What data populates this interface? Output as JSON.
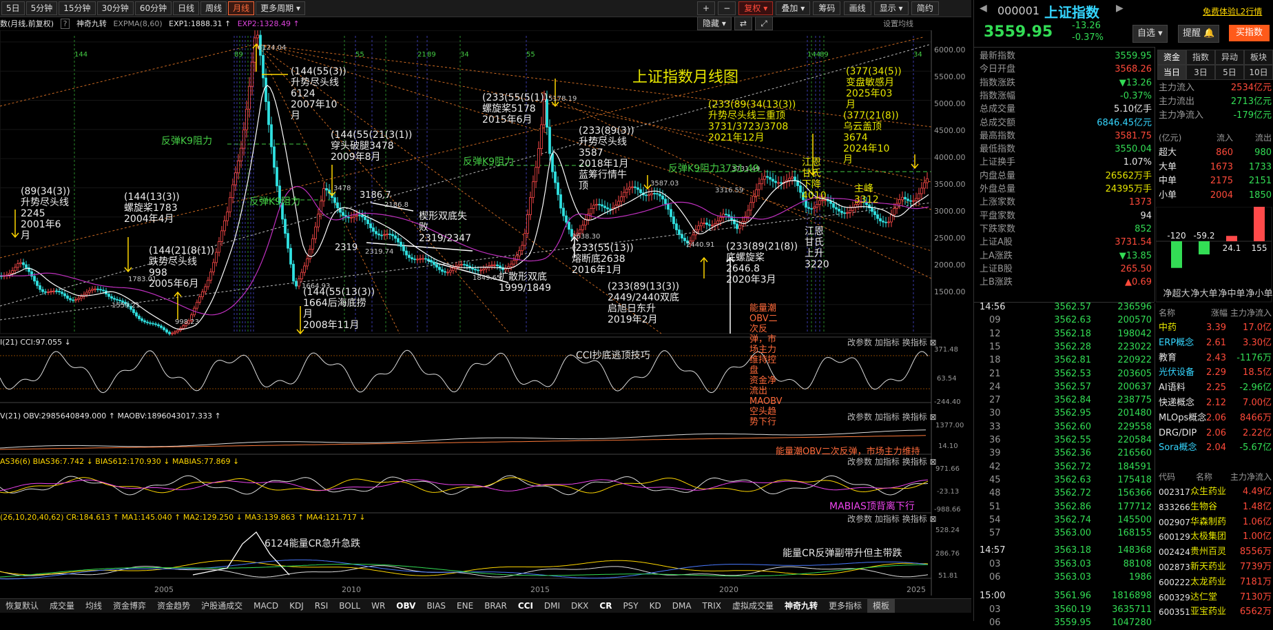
{
  "toolbar": {
    "periods": [
      "5日",
      "5分钟",
      "15分钟",
      "30分钟",
      "60分钟",
      "日线",
      "周线",
      "月线",
      "更多周期"
    ],
    "active_period": "月线",
    "controls": [
      "+",
      "−",
      "复权",
      "叠加",
      "筹码",
      "画线",
      "显示",
      "简约",
      "隐藏"
    ],
    "window_icons": [
      "⇄",
      "⤢"
    ]
  },
  "infoline": {
    "prefix": "数(月线,前复权)",
    "help": "?",
    "indicator": "神奇九转",
    "expma": "EXPMA(8,60)",
    "exp1": "EXP1:1888.31 ↑",
    "exp2": "EXP2:1328.49 ↑",
    "settings": "设置均线"
  },
  "chart": {
    "title": "上证指数月线图",
    "y_ticks": [
      "6000.00",
      "5500.00",
      "5000.00",
      "4500.00",
      "4000.00",
      "3500.00",
      "3000.00",
      "2500.00",
      "2000.00",
      "1500.00"
    ],
    "x_ticks": [
      "2005",
      "2010",
      "2015",
      "2020",
      "2025"
    ],
    "top_numbers": [
      "144",
      "89",
      "55",
      "89",
      "144",
      "89",
      "21",
      "34",
      "55",
      "34"
    ],
    "price_labels": [
      "6124.04",
      "5178.19",
      "3731.49",
      "3587.03",
      "3316.59",
      "3186.7",
      "3478",
      "2319",
      "2319.74",
      "1849.65",
      "1664.93",
      "1783.01",
      "998.23",
      "1559.21",
      "2638.30",
      "2440.91",
      "2186.8"
    ],
    "annotations": [
      {
        "lines": [
          "(144(55(3))",
          "升势尽头线6124",
          "2007年10月"
        ]
      },
      {
        "lines": [
          "(233(55(5(1))",
          "螺旋桨5178",
          "2015年6月"
        ]
      },
      {
        "lines": [
          "(377(34(5))",
          "变盘敏感月",
          "2025年03月"
        ]
      },
      {
        "lines": [
          "(233(89(34(13(3))",
          "升势尽头线三重顶",
          "3731/3723/3708",
          "2021年12月"
        ]
      },
      {
        "lines": [
          "(377(21(8))",
          "乌云盖顶3674",
          "2024年10月"
        ]
      },
      {
        "lines": [
          "(144(55(21(3(1))",
          "穿头破腿3478",
          "2009年8月"
        ]
      },
      {
        "lines": [
          "(233(89(3))",
          "升势尽头线3587",
          "2018年1月蓝筹行情牛顶"
        ]
      },
      {
        "lines": [
          "(89(34(3))",
          "升势尽头线2245",
          "2001年6月"
        ]
      },
      {
        "lines": [
          "(144(13(3))",
          "螺旋桨1783",
          "2004年4月"
        ]
      },
      {
        "lines": [
          "(144(21(8(1))",
          "跌势尽头线998",
          "2005年6月"
        ]
      },
      {
        "lines": [
          "(144(55(13(3))",
          "1664后海底捞月",
          "2008年11月"
        ]
      },
      {
        "lines": [
          "楔形双底失败",
          "2319/2347"
        ]
      },
      {
        "lines": [
          "扩散形双底",
          "1999/1849"
        ]
      },
      {
        "lines": [
          "(233(55(13))",
          "熔断底2638",
          "2016年1月"
        ]
      },
      {
        "lines": [
          "(233(89(13(3))",
          "2449/2440双底",
          "启旭日东升",
          "2019年2月"
        ]
      },
      {
        "lines": [
          "(233(89(21(8))",
          "底螺旋桨2646.8",
          "2020年3月"
        ]
      },
      {
        "lines": [
          "主峰3312"
        ]
      },
      {
        "lines": [
          "江恩甘氏下降4010"
        ]
      },
      {
        "lines": [
          "江恩甘氏上升3220"
        ]
      },
      {
        "lines": [
          "能量潮OBV二次反弹，市场主力维持控盘",
          "资金净流出MAOBV空头趋势下行"
        ]
      }
    ],
    "resist_labels": [
      "反弹K9阻力",
      "反弹K9阻力",
      "反弹K9阻力",
      "反弹K9阻力3731.49"
    ],
    "sub_options": [
      "改参数",
      "加指标",
      "换指标",
      "⊠"
    ],
    "panels": [
      {
        "header": "I(21) CCI:97.055 ↓",
        "note": "CCI抄底逃顶技巧",
        "ticks": [
          "371.48",
          "63.54",
          "-244.40"
        ]
      },
      {
        "header": "V(21) OBV:2985640849.000 ↑ MAOBV:1896043017.333 ↑",
        "note": "能量潮OBV二次反弹，市场主力维持",
        "ticks": [
          "1377.00",
          "14.10"
        ]
      },
      {
        "header": "AS36(6) BIAS36:7.742 ↓ BIAS612:170.930 ↓ MABIAS:77.869 ↓",
        "note": "MABIAS顶背离下行",
        "ticks": [
          "971.66",
          "-23.13",
          "-988.66"
        ]
      },
      {
        "header": "(26,10,20,40,62) CR:184.613 ↑ MA1:145.040 ↑ MA2:129.250 ↓ MA3:139.863 ↑ MA4:121.717 ↓",
        "note1": "6124能量CR急升急跌",
        "note2": "能量CR反弹副带升但主带跌",
        "ticks": [
          "528.24",
          "286.76",
          "51.81"
        ]
      }
    ]
  },
  "bottom_tabs": [
    "恢复默认",
    "成交量",
    "均线",
    "资金博弈",
    "资金趋势",
    "沪股通成交",
    "MACD",
    "KDJ",
    "RSI",
    "BOLL",
    "WR",
    "OBV",
    "BIAS",
    "ENE",
    "BRAR",
    "CCI",
    "DMI",
    "DKX",
    "CR",
    "PSY",
    "KD",
    "DMA",
    "TRIX",
    "虚拟成交量",
    "神奇九转",
    "更多指标",
    "模板"
  ],
  "quote": {
    "code": "000001",
    "name": "上证指数",
    "promo": "免费体验L2行情",
    "price": "3559.95",
    "change": "-13.26",
    "change_pct": "-0.37%",
    "btn_watch": "自选",
    "btn_alert": "提醒",
    "btn_buy": "买指数",
    "stats": [
      {
        "label": "最新指数",
        "value": "3559.95",
        "cls": "dn"
      },
      {
        "label": "今日开盘",
        "value": "3568.26",
        "cls": "up"
      },
      {
        "label": "指数涨跌",
        "value": "▼13.26",
        "cls": "dn"
      },
      {
        "label": "指数涨幅",
        "value": "-0.37%",
        "cls": "dn"
      },
      {
        "label": "总成交量",
        "value": "5.10亿手",
        "cls": "wht"
      },
      {
        "label": "总成交额",
        "value": "6846.45亿元",
        "cls": "cyan"
      },
      {
        "label": "最高指数",
        "value": "3581.75",
        "cls": "up"
      },
      {
        "label": "最低指数",
        "value": "3550.04",
        "cls": "dn"
      },
      {
        "label": "上证换手",
        "value": "1.07%",
        "cls": "wht"
      },
      {
        "label": "内盘总量",
        "value": "26562万手",
        "cls": "yel"
      },
      {
        "label": "外盘总量",
        "value": "24395万手",
        "cls": "yel"
      },
      {
        "label": "上涨家数",
        "value": "1373",
        "cls": "up"
      },
      {
        "label": "平盘家数",
        "value": "94",
        "cls": "wht"
      },
      {
        "label": "下跌家数",
        "value": "852",
        "cls": "dn"
      },
      {
        "label": "上证A股",
        "value": "3731.54",
        "cls": "up"
      },
      {
        "label": "上A涨跌",
        "value": "▼13.85",
        "cls": "dn"
      },
      {
        "label": "上证B股",
        "value": "265.50",
        "cls": "up"
      },
      {
        "label": "上B涨跌",
        "value": "▲0.69",
        "cls": "up"
      }
    ],
    "flow_tabs_1": [
      "资金",
      "指数",
      "异动",
      "板块"
    ],
    "flow_tabs_2": [
      "当日",
      "3日",
      "5日",
      "10日"
    ],
    "main_flow": [
      {
        "label": "主力流入",
        "value": "2534亿元",
        "cls": "up"
      },
      {
        "label": "主力流出",
        "value": "2713亿元",
        "cls": "dn"
      },
      {
        "label": "主力净流入",
        "value": "-179亿元",
        "cls": "dn"
      }
    ],
    "flow_head": [
      "(亿元)",
      "流入",
      "流出"
    ],
    "flow_rows": [
      {
        "label": "超大",
        "in": "860",
        "out": "980"
      },
      {
        "label": "大单",
        "in": "1673",
        "out": "1733"
      },
      {
        "label": "中单",
        "in": "2175",
        "out": "2151"
      },
      {
        "label": "小单",
        "in": "2004",
        "out": "1850"
      }
    ],
    "net_bars": [
      {
        "label": "净超大",
        "value": -120,
        "text": "-120"
      },
      {
        "label": "净大单",
        "value": -59.2,
        "text": "-59.2"
      },
      {
        "label": "净中单",
        "value": 24.1,
        "text": "24.1"
      },
      {
        "label": "净小单",
        "value": 155,
        "text": "155"
      }
    ],
    "ticks": [
      {
        "time": "14:56",
        "price": "3562.57",
        "vol": "236596"
      },
      {
        "time": "09",
        "price": "3562.63",
        "vol": "200570"
      },
      {
        "time": "12",
        "price": "3562.18",
        "vol": "198042"
      },
      {
        "time": "15",
        "price": "3562.28",
        "vol": "223022"
      },
      {
        "time": "18",
        "price": "3562.81",
        "vol": "220922"
      },
      {
        "time": "21",
        "price": "3562.53",
        "vol": "203605"
      },
      {
        "time": "24",
        "price": "3562.57",
        "vol": "200637"
      },
      {
        "time": "27",
        "price": "3562.84",
        "vol": "238775"
      },
      {
        "time": "30",
        "price": "3562.95",
        "vol": "201480"
      },
      {
        "time": "33",
        "price": "3562.60",
        "vol": "229558"
      },
      {
        "time": "36",
        "price": "3562.55",
        "vol": "220584"
      },
      {
        "time": "39",
        "price": "3562.36",
        "vol": "216560"
      },
      {
        "time": "42",
        "price": "3562.72",
        "vol": "184591"
      },
      {
        "time": "45",
        "price": "3562.63",
        "vol": "175418"
      },
      {
        "time": "48",
        "price": "3562.72",
        "vol": "156366"
      },
      {
        "time": "51",
        "price": "3562.86",
        "vol": "177712"
      },
      {
        "time": "54",
        "price": "3562.74",
        "vol": "145500"
      },
      {
        "time": "57",
        "price": "3563.00",
        "vol": "168155"
      },
      {
        "time": "14:57",
        "price": "3563.18",
        "vol": "148368"
      },
      {
        "time": "03",
        "price": "3563.03",
        "vol": "88108"
      },
      {
        "time": "06",
        "price": "3563.03",
        "vol": "1986"
      },
      {
        "time": "15:00",
        "price": "3561.96",
        "vol": "1816898"
      },
      {
        "time": "03",
        "price": "3560.19",
        "vol": "3635711"
      },
      {
        "time": "06",
        "price": "3559.95",
        "vol": "1047280"
      }
    ],
    "sector_head": [
      "名称",
      "涨幅",
      "主力净流入"
    ],
    "sectors": [
      {
        "name": "中药",
        "pct": "3.39",
        "flow": "17.0亿",
        "ncls": "yel",
        "fcls": "up"
      },
      {
        "name": "ERP概念",
        "pct": "2.61",
        "flow": "3.30亿",
        "ncls": "cyan",
        "fcls": "up"
      },
      {
        "name": "教育",
        "pct": "2.43",
        "flow": "-1176万",
        "ncls": "wht",
        "fcls": "dn"
      },
      {
        "name": "光伏设备",
        "pct": "2.29",
        "flow": "18.5亿",
        "ncls": "cyan",
        "fcls": "up"
      },
      {
        "name": "AI语料",
        "pct": "2.25",
        "flow": "-2.96亿",
        "ncls": "wht",
        "fcls": "dn"
      },
      {
        "name": "快递概念",
        "pct": "2.12",
        "flow": "7.00亿",
        "ncls": "wht",
        "fcls": "up"
      },
      {
        "name": "MLOps概念",
        "pct": "2.06",
        "flow": "8466万",
        "ncls": "wht",
        "fcls": "up"
      },
      {
        "name": "DRG/DIP",
        "pct": "2.06",
        "flow": "2.22亿",
        "ncls": "wht",
        "fcls": "up"
      },
      {
        "name": "Sora概念",
        "pct": "2.04",
        "flow": "-5.67亿",
        "ncls": "cyan",
        "fcls": "dn"
      }
    ],
    "stock_head": [
      "代码",
      "名称",
      "主力净流入"
    ],
    "stocks": [
      {
        "code": "002317",
        "name": "众生药业",
        "flow": "4.49亿"
      },
      {
        "code": "833266",
        "name": "生物谷",
        "flow": "1.48亿"
      },
      {
        "code": "002907",
        "name": "华森制药",
        "flow": "1.06亿"
      },
      {
        "code": "600129",
        "name": "太极集团",
        "flow": "1.00亿"
      },
      {
        "code": "002424",
        "name": "贵州百灵",
        "flow": "8556万"
      },
      {
        "code": "002873",
        "name": "新天药业",
        "flow": "7739万"
      },
      {
        "code": "600222",
        "name": "太龙药业",
        "flow": "7181万"
      },
      {
        "code": "600329",
        "name": "达仁堂",
        "flow": "7130万"
      },
      {
        "code": "600351",
        "name": "亚宝药业",
        "flow": "6562万"
      }
    ]
  },
  "colors": {
    "up": "#ff4a3a",
    "down": "#33dd55",
    "accent": "#ff6a3a",
    "yellow": "#e6e600",
    "cyan": "#35d6ff"
  }
}
